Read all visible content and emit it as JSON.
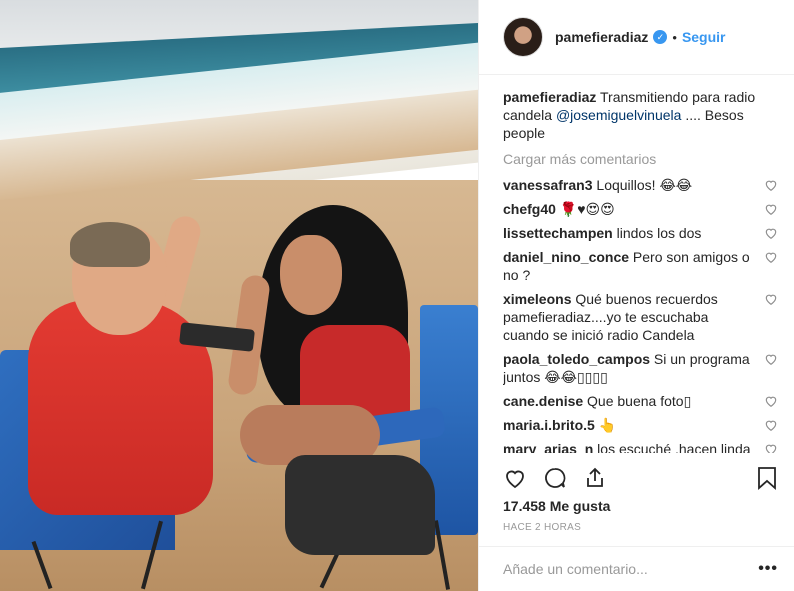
{
  "header": {
    "username": "pamefieradiaz",
    "separator": "•",
    "follow_label": "Seguir"
  },
  "caption": {
    "username": "pamefieradiaz",
    "text_before": " Transmitiendo para radio candela ",
    "mention": "@josemiguelvinuela",
    "text_after": " .... Besos people"
  },
  "load_more_label": "Cargar más comentarios",
  "comments": [
    {
      "user": "vanessafran3",
      "text": " Loquillos! 😂😂"
    },
    {
      "user": "chefg40",
      "text": " 🌹♥😍😍"
    },
    {
      "user": "lissettechampen",
      "text": " lindos los dos"
    },
    {
      "user": "daniel_nino_conce",
      "text": " Pero son amigos o no ?"
    },
    {
      "user": "ximeleons",
      "text": " Qué buenos recuerdos pamefieradiaz....yo te escuchaba cuando se inició radio Candela"
    },
    {
      "user": "paola_toledo_campos",
      "text": " Si un programa juntos 😂😂▯▯▯▯"
    },
    {
      "user": "cane.denise",
      "text": " Que buena foto▯"
    },
    {
      "user": "maria.i.brito.5",
      "text": " 👆"
    },
    {
      "user": "mary_arias_n",
      "text": " los escuché ,hacen linda"
    }
  ],
  "likes": "17.458 Me gusta",
  "timestamp": "HACE 2 HORAS",
  "add_comment_placeholder": "Añade un comentario...",
  "options_label": "•••"
}
